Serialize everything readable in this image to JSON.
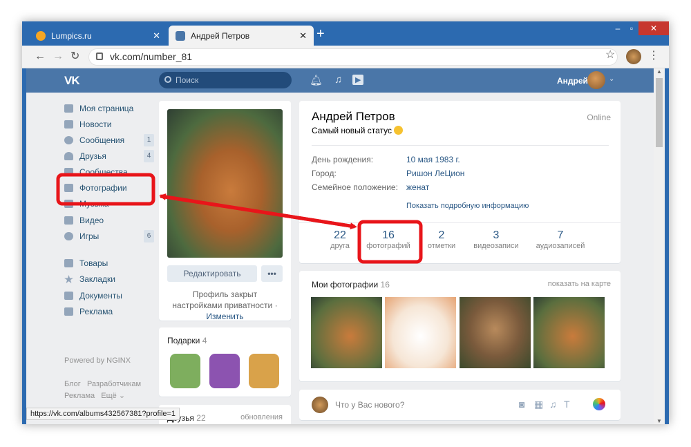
{
  "browser": {
    "tabs": [
      {
        "title": "Lumpics.ru",
        "color": "#f5a623"
      },
      {
        "title": "Андрей Петров",
        "color": "#4a76a8"
      }
    ],
    "url": "vk.com/number_81",
    "status_url": "https://vk.com/albums432567381?profile=1"
  },
  "vk": {
    "logo": "VK",
    "search_placeholder": "Поиск",
    "user_name": "Андрей"
  },
  "menu": {
    "items": [
      {
        "label": "Моя страница",
        "badge": ""
      },
      {
        "label": "Новости",
        "badge": ""
      },
      {
        "label": "Сообщения",
        "badge": "1"
      },
      {
        "label": "Друзья",
        "badge": "4"
      },
      {
        "label": "Сообщества",
        "badge": ""
      },
      {
        "label": "Фотографии",
        "badge": ""
      },
      {
        "label": "Музыка",
        "badge": ""
      },
      {
        "label": "Видео",
        "badge": ""
      },
      {
        "label": "Игры",
        "badge": "6"
      },
      {
        "label": "Товары",
        "badge": ""
      },
      {
        "label": "Закладки",
        "badge": ""
      },
      {
        "label": "Документы",
        "badge": ""
      },
      {
        "label": "Реклама",
        "badge": ""
      }
    ],
    "powered": "Powered by NGINX",
    "footer_links": [
      "Блог",
      "Разработчикам",
      "Реклама",
      "Ещё"
    ]
  },
  "profile": {
    "name": "Андрей Петров",
    "online": "Online",
    "status": "Самый новый статус",
    "fields": [
      {
        "label": "День рождения:",
        "value": "10 мая 1983 г."
      },
      {
        "label": "Город:",
        "value": "Ришон ЛеЦион"
      },
      {
        "label": "Семейное положение:",
        "value": "женат"
      }
    ],
    "show_more": "Показать подробную информацию",
    "stats": [
      {
        "n": "22",
        "l": "друга"
      },
      {
        "n": "16",
        "l": "фотографий"
      },
      {
        "n": "2",
        "l": "отметки"
      },
      {
        "n": "3",
        "l": "видеозаписи"
      },
      {
        "n": "7",
        "l": "аудиозаписей"
      }
    ],
    "edit_button": "Редактировать",
    "privacy_text": "Профиль закрыт настройками приватности",
    "privacy_change": "Изменить"
  },
  "gifts": {
    "title": "Подарки",
    "count": "4"
  },
  "friends": {
    "title": "Друзья",
    "count": "22",
    "updates": "обновления"
  },
  "photos": {
    "title": "Мои фотографии",
    "count": "16",
    "map_link": "показать на карте"
  },
  "post": {
    "placeholder": "Что у Вас нового?"
  },
  "colors": {
    "vk_blue": "#4a76a8",
    "highlight_red": "#e8151a"
  }
}
